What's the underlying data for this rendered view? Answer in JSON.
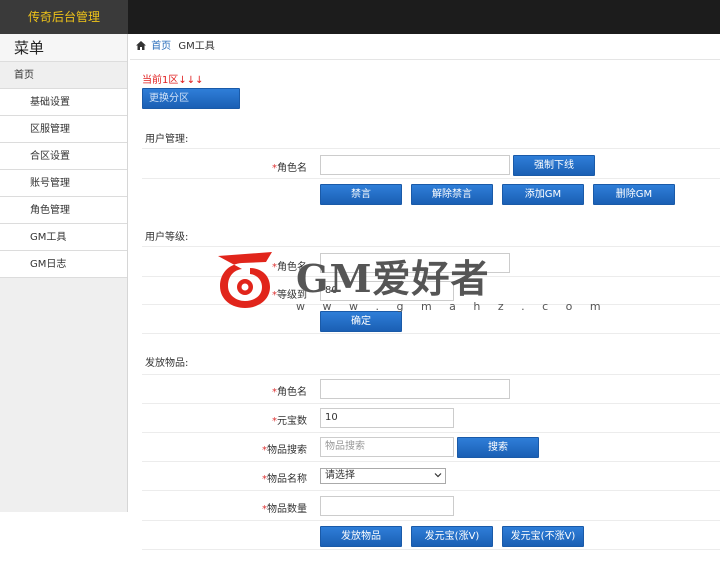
{
  "app": {
    "title": "传奇后台管理"
  },
  "sidebar": {
    "title": "菜单",
    "home": "首页",
    "items": [
      {
        "label": "基础设置"
      },
      {
        "label": "区服管理"
      },
      {
        "label": "合区设置"
      },
      {
        "label": "账号管理"
      },
      {
        "label": "角色管理"
      },
      {
        "label": "GM工具"
      },
      {
        "label": "GM日志"
      }
    ]
  },
  "breadcrumb": {
    "home": "首页",
    "current": "GM工具"
  },
  "zone": {
    "current_text": "当前1区↓↓↓",
    "change_button": "更换分区"
  },
  "user_mgmt": {
    "title": "用户管理:",
    "role_label": "角色名",
    "role_value": "",
    "force_offline": "强制下线",
    "ban_chat": "禁言",
    "unban_chat": "解除禁言",
    "add_gm": "添加GM",
    "remove_gm": "删除GM"
  },
  "user_level": {
    "title": "用户等级:",
    "role_label": "角色名",
    "role_value": "",
    "level_label": "等级到",
    "level_value": "80",
    "confirm": "确定"
  },
  "items": {
    "title": "发放物品:",
    "role_label": "角色名",
    "role_value": "",
    "gold_label": "元宝数",
    "gold_value": "10",
    "search_label": "物品搜索",
    "search_placeholder": "物品搜索",
    "search_button": "搜索",
    "name_label": "物品名称",
    "name_selected": "请选择",
    "qty_label": "物品数量",
    "qty_value": "",
    "send_item": "发放物品",
    "send_gold_v": "发元宝(涨V)",
    "send_gold_nov": "发元宝(不涨V)"
  },
  "watermark": {
    "title": "GM爱好者",
    "url": "w w w . g m a h z . c o m"
  },
  "colors": {
    "topbar": "#1c1c1c",
    "brand_text": "#f0c419",
    "button": "#1f66bf",
    "required_star": "#dd3333",
    "zone_text": "#e02020",
    "watermark_red": "#e1251b"
  }
}
